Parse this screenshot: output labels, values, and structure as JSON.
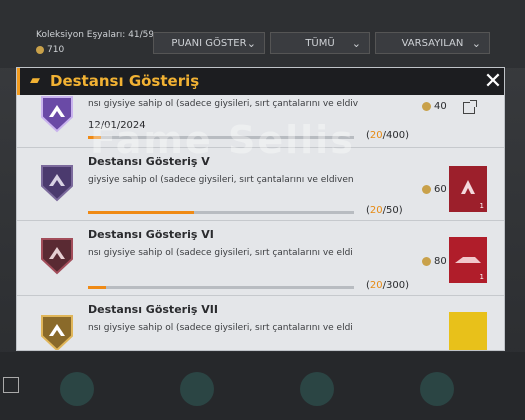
{
  "background": {
    "collection_label": "Koleksiyon Eşyaları: 41/59",
    "coins": "710",
    "dropdowns": [
      {
        "label": "PUANI GÖSTER"
      },
      {
        "label": "TÜMÜ"
      },
      {
        "label": "VARSAYILAN"
      }
    ]
  },
  "modal": {
    "title": "Destansı Gösteriş",
    "close_label": "✕",
    "items": [
      {
        "title": "",
        "description": "nsı giysiye sahip ol (sadece giysileri, sırt çantalarını ve eldiv",
        "date": "12/01/2024",
        "progress_current": "20",
        "progress_total": "/400)",
        "progress_open": "(",
        "progress_fraction": 0.05,
        "reward": "40",
        "action": "share"
      },
      {
        "title": "Destansı Gösteriş V",
        "description": "giysiye sahip ol (sadece giysileri, sırt çantalarını ve eldiven",
        "date": "",
        "progress_current": "20",
        "progress_total": "/50)",
        "progress_open": "(",
        "progress_fraction": 0.4,
        "reward": "60",
        "thumb_count": "1"
      },
      {
        "title": "Destansı Gösteriş VI",
        "description": "nsı giysiye sahip ol (sadece giysileri, sırt çantalarını ve eldi",
        "date": "",
        "progress_current": "20",
        "progress_total": "/300)",
        "progress_open": "(",
        "progress_fraction": 0.067,
        "reward": "80",
        "thumb_count": "1"
      },
      {
        "title": "Destansı Gösteriş VII",
        "description": "nsı giysiye sahip ol (sadece giysileri, sırt çantalarını ve eldi",
        "date": "",
        "progress_current": "",
        "progress_total": "",
        "progress_open": "",
        "progress_fraction": 0,
        "reward": ""
      }
    ]
  },
  "watermark": "Fame Sellis",
  "colors": {
    "accent": "#f2b233",
    "progress": "#ef8a15",
    "header": "#1c1d20"
  }
}
